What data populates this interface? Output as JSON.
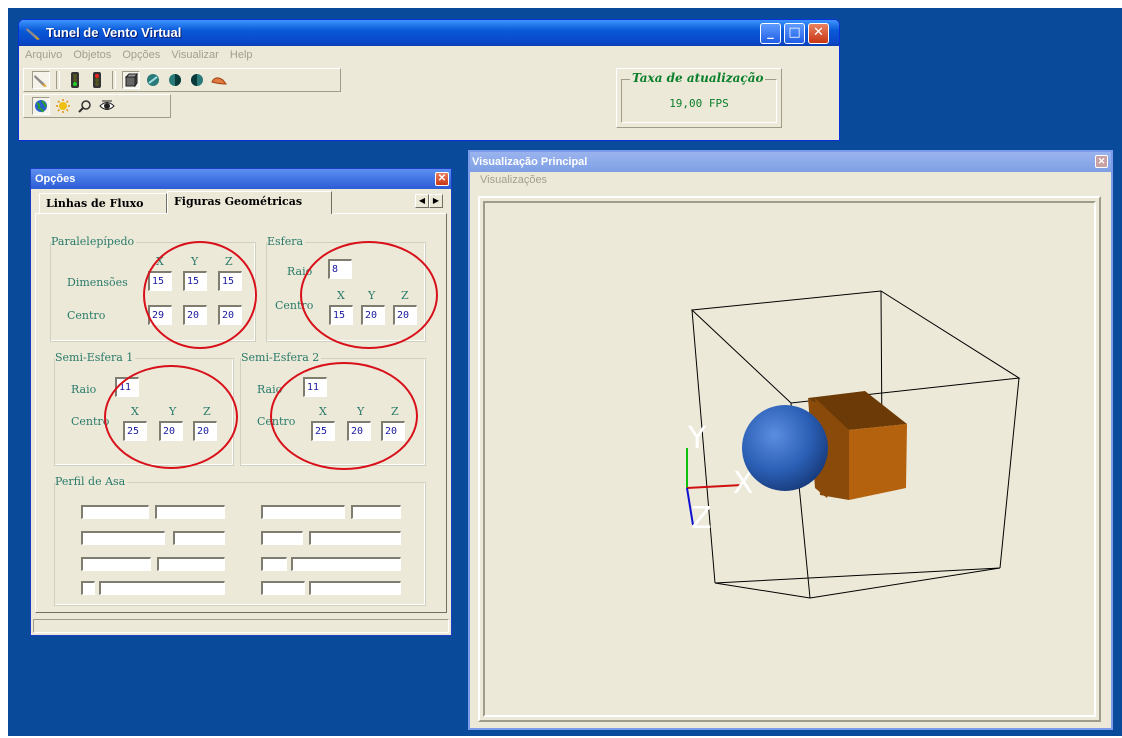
{
  "main_window": {
    "title": "Tunel de Vento Virtual",
    "menu": [
      "Arquivo",
      "Objetos",
      "Opções",
      "Visualizar",
      "Help"
    ],
    "caption_buttons": {
      "minimize": "_",
      "maximize": "□",
      "close": "✕"
    },
    "toolbar_row1": [
      "wind-tunnel-icon",
      "traffic-light-green-icon",
      "traffic-light-red-icon",
      "cube-icon",
      "disk-icon",
      "half-sphere-icon",
      "half-sphere-2-icon",
      "wing-profile-icon"
    ],
    "toolbar_row2": [
      "globe-icon",
      "sun-icon",
      "magnifier-icon",
      "eye-icon"
    ],
    "fps_label": "Taxa de atualização",
    "fps_value": "19,00  FPS"
  },
  "options_window": {
    "title": "Opções",
    "close": "✕",
    "tabs": [
      "Linhas de Fluxo",
      "Figuras Geométricas"
    ],
    "active_tab": "Figuras Geométricas",
    "tab_scroll": {
      "left": "◀",
      "right": "▶"
    },
    "paralelepipedo": {
      "legend": "Paralelepípedo",
      "axis": [
        "X",
        "Y",
        "Z"
      ],
      "dim_label": "Dimensões",
      "dimensions": [
        "15",
        "15",
        "15"
      ],
      "center_label": "Centro",
      "center": [
        "29",
        "20",
        "20"
      ]
    },
    "esfera": {
      "legend": "Esfera",
      "radius_label": "Raio",
      "radius": "8",
      "center_label": "Centro",
      "axis": [
        "X",
        "Y",
        "Z"
      ],
      "center": [
        "15",
        "20",
        "20"
      ]
    },
    "semi_esfera_1": {
      "legend": "Semi-Esfera 1",
      "radius_label": "Raio",
      "radius": "11",
      "center_label": "Centro",
      "axis": [
        "X",
        "Y",
        "Z"
      ],
      "center": [
        "25",
        "20",
        "20"
      ]
    },
    "semi_esfera_2": {
      "legend": "Semi-Esfera 2",
      "radius_label": "Raio",
      "radius": "11",
      "center_label": "Centro",
      "axis": [
        "X",
        "Y",
        "Z"
      ],
      "center": [
        "25",
        "20",
        "20"
      ]
    },
    "perfil_asa": {
      "legend": "Perfil de Asa"
    }
  },
  "vis_window": {
    "title": "Visualização Principal",
    "close": "✕",
    "menu": [
      "Visualizações"
    ],
    "scene": {
      "axis_labels": [
        "Y",
        "X",
        "Z"
      ],
      "colors": {
        "sphere": "#2b5fb5",
        "box": "#b5620f",
        "box_top": "#6b3a06",
        "axis_x": "#d01010",
        "axis_y": "#10c010",
        "axis_z": "#1010d0"
      }
    }
  },
  "colors": {
    "desktop": "#0a4a9a",
    "window": "#ece9d8",
    "highlight": "#d8101a",
    "label": "#2a7a6a"
  }
}
